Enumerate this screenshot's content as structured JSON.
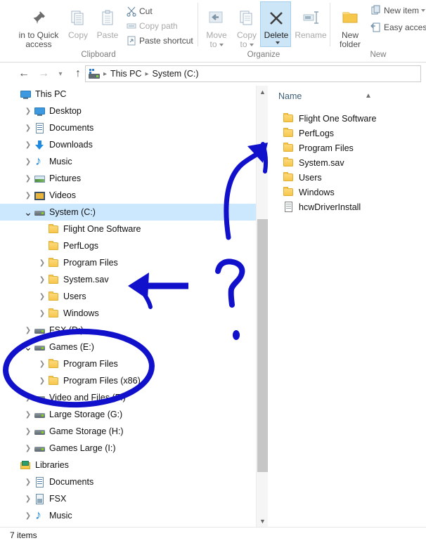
{
  "ribbon": {
    "groups": [
      {
        "title": "Clipboard"
      },
      {
        "title": "Organize"
      },
      {
        "title": "New"
      }
    ],
    "pin_label_line1": "in to Quick",
    "pin_label_line2": "access",
    "copy_label": "Copy",
    "paste_label": "Paste",
    "cut_label": "Cut",
    "copy_path_label": "Copy path",
    "paste_shortcut_label": "Paste shortcut",
    "move_to_line1": "Move",
    "move_to_line2": "to",
    "copy_to_line1": "Copy",
    "copy_to_line2": "to",
    "delete_label": "Delete",
    "rename_label": "Rename",
    "new_folder_line1": "New",
    "new_folder_line2": "folder",
    "new_item_label": "New item",
    "easy_access_label": "Easy access"
  },
  "address": {
    "back_icon": "back-arrow-icon",
    "forward_icon": "forward-arrow-icon",
    "recent_icon": "chevron-down-icon",
    "up_icon": "up-arrow-icon",
    "drive_icon": "drive-icon",
    "breadcrumbs": [
      "This PC",
      "System (C:)"
    ]
  },
  "tree": {
    "items": [
      {
        "label": "This PC",
        "indent": 0,
        "icon": "pc",
        "chev": "none",
        "selected": false
      },
      {
        "label": "Desktop",
        "indent": 1,
        "icon": "pc",
        "chev": "closed",
        "selected": false
      },
      {
        "label": "Documents",
        "indent": 1,
        "icon": "doc",
        "chev": "closed",
        "selected": false
      },
      {
        "label": "Downloads",
        "indent": 1,
        "icon": "dl",
        "chev": "closed",
        "selected": false
      },
      {
        "label": "Music",
        "indent": 1,
        "icon": "music",
        "chev": "closed",
        "selected": false
      },
      {
        "label": "Pictures",
        "indent": 1,
        "icon": "pic",
        "chev": "closed",
        "selected": false
      },
      {
        "label": "Videos",
        "indent": 1,
        "icon": "vid",
        "chev": "closed",
        "selected": false
      },
      {
        "label": "System (C:)",
        "indent": 1,
        "icon": "drive",
        "chev": "open",
        "selected": true
      },
      {
        "label": "Flight One Software",
        "indent": 2,
        "icon": "folder",
        "chev": "none",
        "selected": false
      },
      {
        "label": "PerfLogs",
        "indent": 2,
        "icon": "folder",
        "chev": "none",
        "selected": false
      },
      {
        "label": "Program Files",
        "indent": 2,
        "icon": "folder",
        "chev": "closed",
        "selected": false
      },
      {
        "label": "System.sav",
        "indent": 2,
        "icon": "folder",
        "chev": "closed",
        "selected": false
      },
      {
        "label": "Users",
        "indent": 2,
        "icon": "folder",
        "chev": "closed",
        "selected": false
      },
      {
        "label": "Windows",
        "indent": 2,
        "icon": "folder",
        "chev": "closed",
        "selected": false
      },
      {
        "label": "FSX (D:)",
        "indent": 1,
        "icon": "drive",
        "chev": "closed",
        "selected": false
      },
      {
        "label": "Games (E:)",
        "indent": 1,
        "icon": "drive",
        "chev": "open",
        "selected": false
      },
      {
        "label": "Program Files",
        "indent": 2,
        "icon": "folder",
        "chev": "closed",
        "selected": false
      },
      {
        "label": "Program Files (x86)",
        "indent": 2,
        "icon": "folder",
        "chev": "closed",
        "selected": false
      },
      {
        "label": "Video and Files (F:)",
        "indent": 1,
        "icon": "drive",
        "chev": "closed",
        "selected": false
      },
      {
        "label": "Large Storage (G:)",
        "indent": 1,
        "icon": "drive",
        "chev": "closed",
        "selected": false
      },
      {
        "label": "Game Storage (H:)",
        "indent": 1,
        "icon": "drive",
        "chev": "closed",
        "selected": false
      },
      {
        "label": "Games Large (I:)",
        "indent": 1,
        "icon": "drive",
        "chev": "closed",
        "selected": false
      },
      {
        "label": "Libraries",
        "indent": 0,
        "icon": "lib",
        "chev": "none",
        "selected": false
      },
      {
        "label": "Documents",
        "indent": 1,
        "icon": "doc",
        "chev": "closed",
        "selected": false
      },
      {
        "label": "FSX",
        "indent": 1,
        "icon": "app",
        "chev": "closed",
        "selected": false
      },
      {
        "label": "Music",
        "indent": 1,
        "icon": "music",
        "chev": "closed",
        "selected": false
      }
    ]
  },
  "scrollbar": {
    "up_icon": "chevron-up-icon",
    "down_icon": "chevron-down-icon"
  },
  "list": {
    "column_header": "Name",
    "sort_indicator": "chevron-up-icon",
    "rows": [
      {
        "name": "Flight One Software",
        "icon": "folder"
      },
      {
        "name": "PerfLogs",
        "icon": "folder"
      },
      {
        "name": "Program Files",
        "icon": "folder"
      },
      {
        "name": "System.sav",
        "icon": "folder"
      },
      {
        "name": "Users",
        "icon": "folder"
      },
      {
        "name": "Windows",
        "icon": "folder"
      },
      {
        "name": "hcwDriverInstall",
        "icon": "file"
      }
    ]
  },
  "status": {
    "item_count": "7 items"
  },
  "annotations": {
    "ink_color": "#1111CC",
    "marks": [
      {
        "name": "curved-up-arrow",
        "meaning": "points up to the file list / scrollbar top"
      },
      {
        "name": "left-arrow",
        "meaning": "points left at the System (C:) subfolders"
      },
      {
        "name": "question-mark",
        "meaning": "hand-drawn question mark"
      },
      {
        "name": "ellipse-circle",
        "meaning": "circles Games (E:) and its Program Files folders"
      }
    ]
  },
  "colors": {
    "selection": "#CCE8FF",
    "ribbon_text": "#4C4C4C",
    "ribbon_group_title": "#7B7B7B",
    "folder_yellow": "#F5C74C",
    "ink_blue": "#1111CC",
    "scrollbar_thumb": "#C6C6C6"
  }
}
